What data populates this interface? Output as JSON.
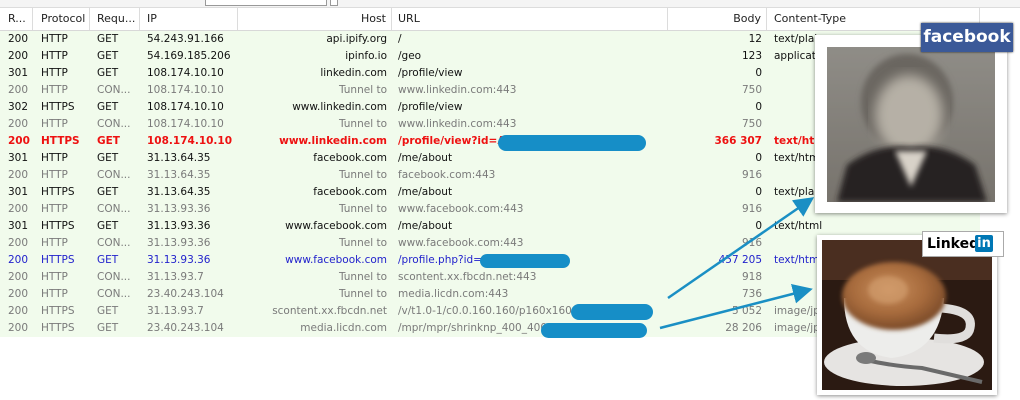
{
  "headers": {
    "result": "R...",
    "protocol": "Protocol",
    "request": "Requ...",
    "ip": "IP",
    "host": "Host",
    "url": "URL",
    "body": "Body",
    "content_type": "Content-Type"
  },
  "sessions": [
    {
      "result": "200",
      "protocol": "HTTP",
      "request": "GET",
      "ip": "54.243.91.166",
      "host": "api.ipify.org",
      "url": "/",
      "body": "12",
      "ctype": "text/plain"
    },
    {
      "result": "200",
      "protocol": "HTTP",
      "request": "GET",
      "ip": "54.169.185.206",
      "host": "ipinfo.io",
      "url": "/geo",
      "body": "123",
      "ctype": "application"
    },
    {
      "result": "301",
      "protocol": "HTTP",
      "request": "GET",
      "ip": "108.174.10.10",
      "host": "linkedin.com",
      "url": "/profile/view",
      "body": "0",
      "ctype": ""
    },
    {
      "result": "200",
      "protocol": "HTTP",
      "request": "CON...",
      "ip": "108.174.10.10",
      "host": "Tunnel to",
      "url": "www.linkedin.com:443",
      "body": "750",
      "ctype": ""
    },
    {
      "result": "302",
      "protocol": "HTTPS",
      "request": "GET",
      "ip": "108.174.10.10",
      "host": "www.linkedin.com",
      "url": "/profile/view",
      "body": "0",
      "ctype": ""
    },
    {
      "result": "200",
      "protocol": "HTTP",
      "request": "CON...",
      "ip": "108.174.10.10",
      "host": "Tunnel to",
      "url": "www.linkedin.com:443",
      "body": "750",
      "ctype": ""
    },
    {
      "result": "200",
      "protocol": "HTTPS",
      "request": "GET",
      "ip": "108.174.10.10",
      "host": "www.linkedin.com",
      "url": "/profile/view?id=A...",
      "body": "366 307",
      "ctype": "text/html"
    },
    {
      "result": "301",
      "protocol": "HTTP",
      "request": "GET",
      "ip": "31.13.64.35",
      "host": "facebook.com",
      "url": "/me/about",
      "body": "0",
      "ctype": "text/html"
    },
    {
      "result": "200",
      "protocol": "HTTP",
      "request": "CON...",
      "ip": "31.13.64.35",
      "host": "Tunnel to",
      "url": "facebook.com:443",
      "body": "916",
      "ctype": ""
    },
    {
      "result": "301",
      "protocol": "HTTPS",
      "request": "GET",
      "ip": "31.13.64.35",
      "host": "facebook.com",
      "url": "/me/about",
      "body": "0",
      "ctype": "text/plain"
    },
    {
      "result": "200",
      "protocol": "HTTP",
      "request": "CON...",
      "ip": "31.13.93.36",
      "host": "Tunnel to",
      "url": "www.facebook.com:443",
      "body": "916",
      "ctype": ""
    },
    {
      "result": "301",
      "protocol": "HTTPS",
      "request": "GET",
      "ip": "31.13.93.36",
      "host": "www.facebook.com",
      "url": "/me/about",
      "body": "0",
      "ctype": "text/html"
    },
    {
      "result": "200",
      "protocol": "HTTP",
      "request": "CON...",
      "ip": "31.13.93.36",
      "host": "Tunnel to",
      "url": "www.facebook.com:443",
      "body": "916",
      "ctype": ""
    },
    {
      "result": "200",
      "protocol": "HTTPS",
      "request": "GET",
      "ip": "31.13.93.36",
      "host": "www.facebook.com",
      "url": "/profile.php?id=1                    &sk=about",
      "body": "457 205",
      "ctype": "text/html"
    },
    {
      "result": "200",
      "protocol": "HTTP",
      "request": "CON...",
      "ip": "31.13.93.7",
      "host": "Tunnel to",
      "url": "scontent.xx.fbcdn.net:443",
      "body": "918",
      "ctype": ""
    },
    {
      "result": "200",
      "protocol": "HTTP",
      "request": "CON...",
      "ip": "23.40.243.104",
      "host": "Tunnel to",
      "url": "media.licdn.com:443",
      "body": "736",
      "ctype": ""
    },
    {
      "result": "200",
      "protocol": "HTTPS",
      "request": "GET",
      "ip": "31.13.93.7",
      "host": "scontent.xx.fbcdn.net",
      "url": "/v/t1.0-1/c0.0.160.160/p160x160/",
      "body": "5 052",
      "ctype": "image/jpeg"
    },
    {
      "result": "200",
      "protocol": "HTTPS",
      "request": "GET",
      "ip": "23.40.243.104",
      "host": "media.licdn.com",
      "url": "/mpr/mpr/shrinknp_400_400/",
      "body": "28 206",
      "ctype": "image/jpeg"
    }
  ],
  "row_styles": [
    "normal",
    "normal",
    "normal",
    "gray",
    "normal",
    "gray",
    "red",
    "normal",
    "gray",
    "normal",
    "gray",
    "normal",
    "gray",
    "blue",
    "gray",
    "gray",
    "gray",
    "gray"
  ],
  "badges": {
    "facebook": "facebook",
    "linkedin_text": "Linked",
    "linkedin_in": "in"
  },
  "colors": {
    "row_bg": "#f1fbec",
    "red_row": "#ee1111",
    "blue_row": "#2222cc",
    "gray_row": "#7a7a7a",
    "redaction": "#168ec7",
    "facebook_brand": "#3b5998",
    "linkedin_brand": "#0077b5"
  }
}
